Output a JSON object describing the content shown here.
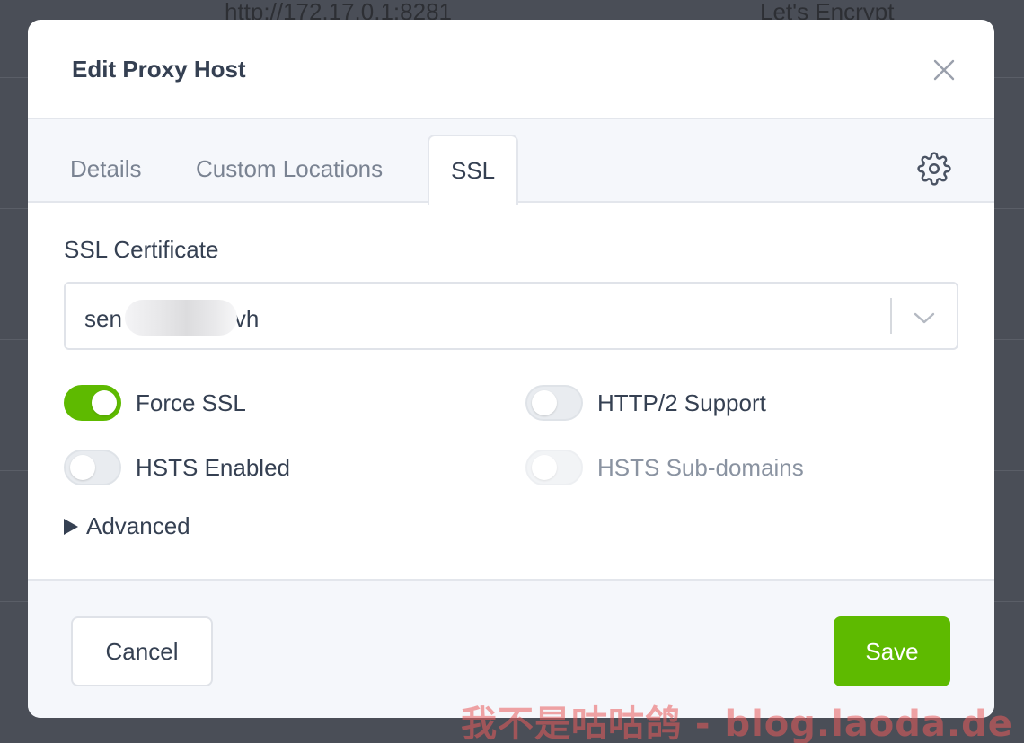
{
  "background": {
    "row_text_left": "http://172.17.0.1:8281",
    "row_text_right": "Let's Encrypt"
  },
  "modal": {
    "title": "Edit Proxy Host",
    "tabs": [
      {
        "label": "Details",
        "active": false
      },
      {
        "label": "Custom Locations",
        "active": false
      },
      {
        "label": "SSL",
        "active": true
      }
    ],
    "ssl": {
      "certificate_label": "SSL Certificate",
      "certificate_value_start": "sen",
      "certificate_value_end": "vh",
      "toggles": {
        "force_ssl": {
          "label": "Force SSL",
          "on": true
        },
        "http2": {
          "label": "HTTP/2 Support",
          "on": false
        },
        "hsts": {
          "label": "HSTS Enabled",
          "on": false
        },
        "hsts_sub": {
          "label": "HSTS Sub-domains",
          "on": false,
          "disabled": true
        }
      },
      "advanced_label": "Advanced"
    },
    "footer": {
      "cancel_label": "Cancel",
      "save_label": "Save"
    }
  },
  "colors": {
    "accent_green": "#5eba00",
    "text": "#354052",
    "muted": "#7a8392"
  },
  "watermark": "我不是咕咕鸽 - blog.laoda.de"
}
